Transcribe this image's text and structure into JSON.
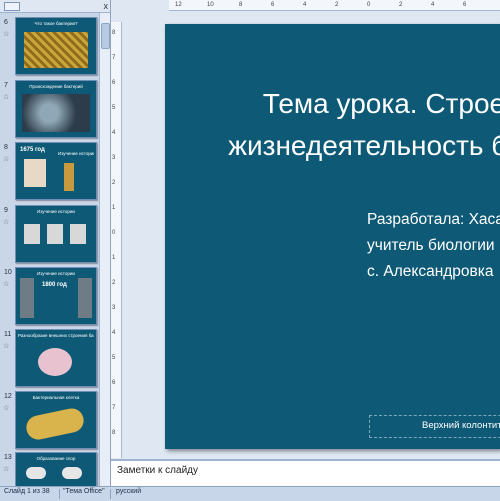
{
  "thumbnail_pane": {
    "close_glyph": "x",
    "slides": [
      {
        "number": "6",
        "title": "Что такое бактерии?"
      },
      {
        "number": "7",
        "title": "Происхождение бактерий"
      },
      {
        "number": "8",
        "title": "Изучение истории",
        "year": "1675 год"
      },
      {
        "number": "9",
        "title": "Изучение истории"
      },
      {
        "number": "10",
        "title": "Изучение истории",
        "year": "1800 год"
      },
      {
        "number": "11",
        "title": "Разнообразие внешних строения бактериальных клеток"
      },
      {
        "number": "12",
        "title": "Бактериальная клетка"
      },
      {
        "number": "13",
        "title": "Образование спор"
      }
    ]
  },
  "rulers": {
    "horizontal": [
      "12",
      "10",
      "8",
      "6",
      "4",
      "2",
      "0",
      "2",
      "4",
      "6"
    ],
    "vertical": [
      "8",
      "7",
      "6",
      "5",
      "4",
      "3",
      "2",
      "1",
      "0",
      "1",
      "2",
      "3",
      "4",
      "5",
      "6",
      "7",
      "8"
    ]
  },
  "slide": {
    "title": "Тема урока. Строение и\nжизнедеятельность бактерий",
    "subtitle": "Разработала: Хасанова\nучитель биологии\nс. Александровка",
    "footer": "Верхний колонтитул"
  },
  "notes": {
    "placeholder": "Заметки к слайду"
  },
  "status_bar": {
    "slide_info": "Слайд 1 из 38",
    "theme": "\"Тема Office\"",
    "language": "русский"
  },
  "colors": {
    "slide_background": "#0e5a76",
    "pane_background": "#c9d6e8",
    "workspace_background": "#dfe7f2"
  }
}
